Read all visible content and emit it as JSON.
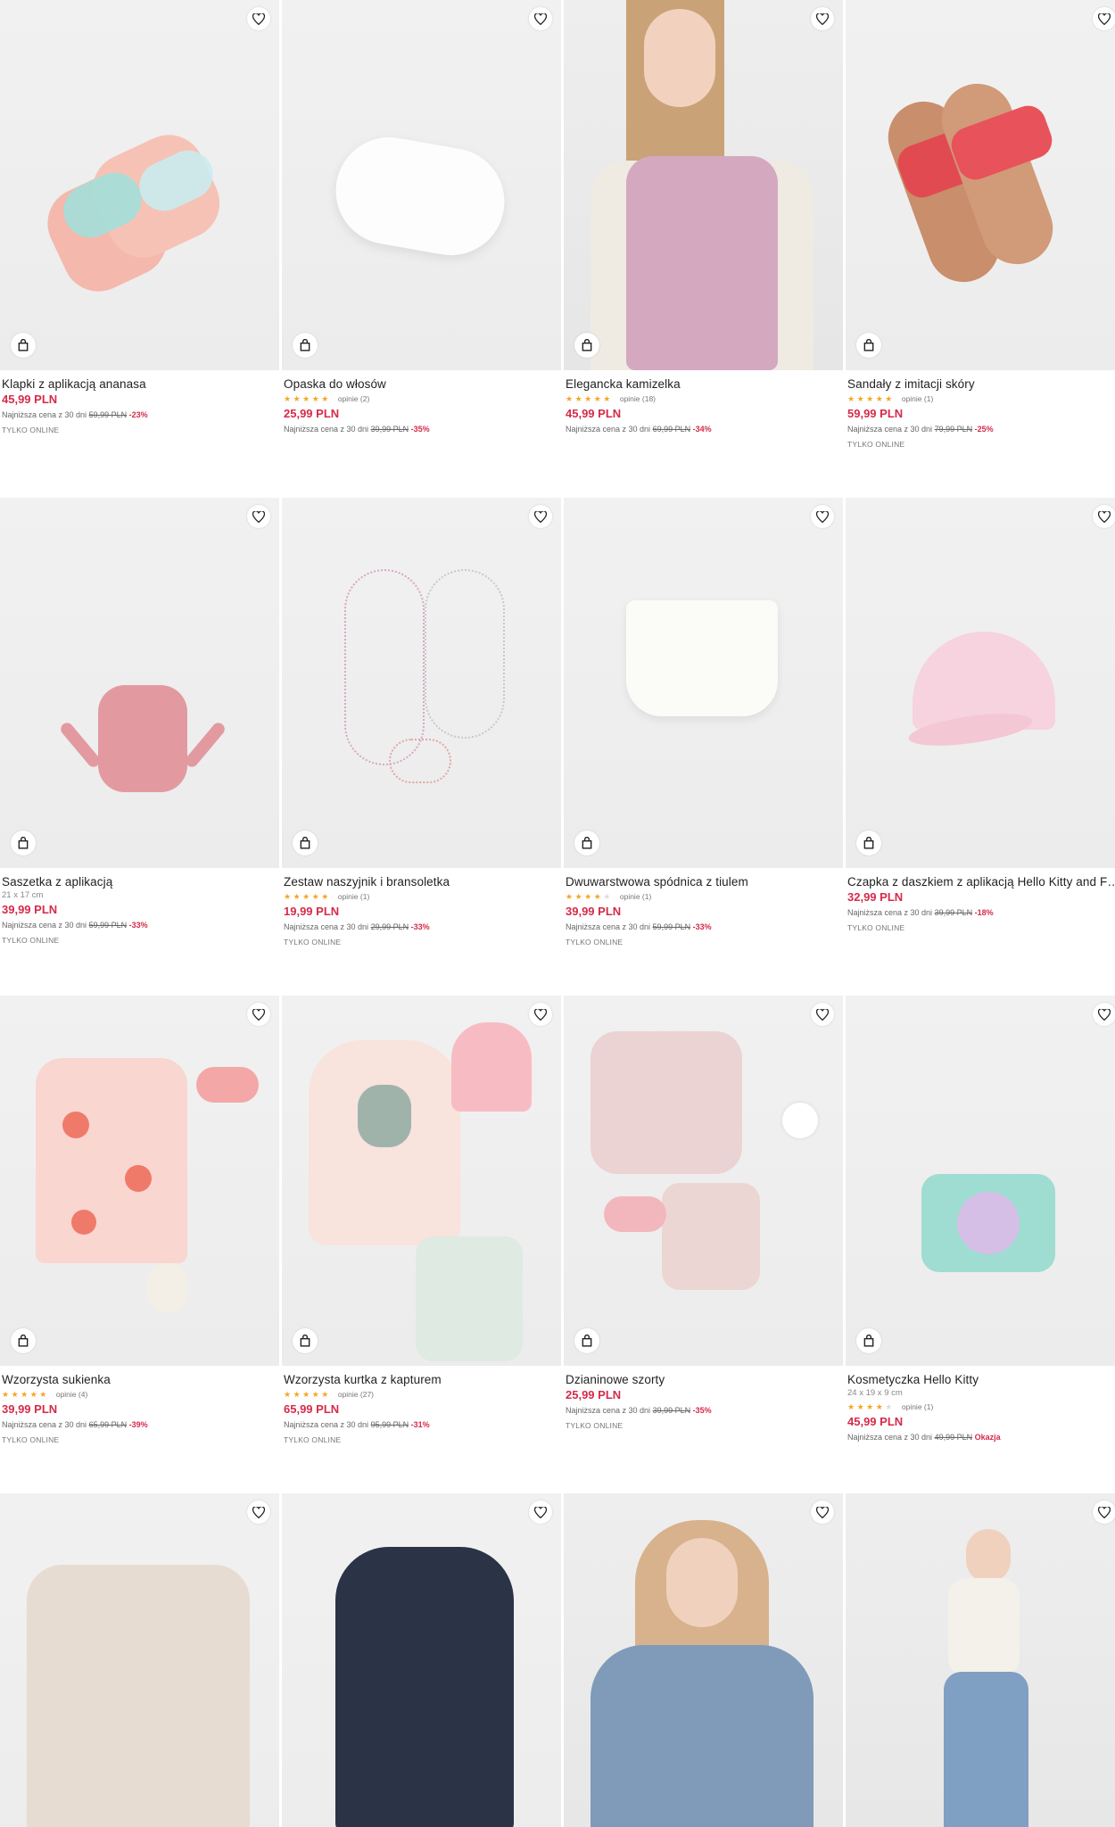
{
  "products": [
    {
      "name": "Klapki z aplikacją ananasa",
      "price": "45,99 PLN",
      "lowest_label": "Najniższa cena z 30 dni",
      "old_price": "59,99 PLN",
      "discount": "-23%",
      "badge": "TYLKO ONLINE"
    },
    {
      "name": "Opaska do włosów",
      "stars": "★★★★★",
      "reviews": "opinie (2)",
      "price": "25,99 PLN",
      "lowest_label": "Najniższa cena z 30 dni",
      "old_price": "39,99 PLN",
      "discount": "-35%"
    },
    {
      "name": "Elegancka kamizelka",
      "stars": "★★★★★",
      "reviews": "opinie (18)",
      "price": "45,99 PLN",
      "lowest_label": "Najniższa cena z 30 dni",
      "old_price": "69,99 PLN",
      "discount": "-34%"
    },
    {
      "name": "Sandały z imitacji skóry",
      "stars": "★★★★★",
      "reviews": "opinie (1)",
      "price": "59,99 PLN",
      "lowest_label": "Najniższa cena z 30 dni",
      "old_price": "79,99 PLN",
      "discount": "-25%",
      "badge": "TYLKO ONLINE"
    },
    {
      "name": "Saszetka z aplikacją",
      "dims": "21 x 17 cm",
      "price": "39,99 PLN",
      "lowest_label": "Najniższa cena z 30 dni",
      "old_price": "59,99 PLN",
      "discount": "-33%",
      "badge": "TYLKO ONLINE"
    },
    {
      "name": "Zestaw naszyjnik i bransoletka",
      "stars": "★★★★★",
      "reviews": "opinie (1)",
      "price": "19,99 PLN",
      "lowest_label": "Najniższa cena z 30 dni",
      "old_price": "29,99 PLN",
      "discount": "-33%",
      "badge": "TYLKO ONLINE"
    },
    {
      "name": "Dwuwarstwowa spódnica z tiulem",
      "stars": "★★★★",
      "stars_off": "★",
      "reviews": "opinie (1)",
      "price": "39,99 PLN",
      "lowest_label": "Najniższa cena z 30 dni",
      "old_price": "59,99 PLN",
      "discount": "-33%",
      "badge": "TYLKO ONLINE"
    },
    {
      "name": "Czapka z daszkiem z aplikacją Hello Kitty and Friends",
      "price": "32,99 PLN",
      "lowest_label": "Najniższa cena z 30 dni",
      "old_price": "39,99 PLN",
      "discount": "-18%",
      "badge": "TYLKO ONLINE"
    },
    {
      "name": "Wzorzysta sukienka",
      "stars": "★★★★★",
      "reviews": "opinie (4)",
      "price": "39,99 PLN",
      "lowest_label": "Najniższa cena z 30 dni",
      "old_price": "65,99 PLN",
      "discount": "-39%",
      "badge": "TYLKO ONLINE"
    },
    {
      "name": "Wzorzysta kurtka z kapturem",
      "stars": "★★★★★",
      "reviews": "opinie (27)",
      "price": "65,99 PLN",
      "lowest_label": "Najniższa cena z 30 dni",
      "old_price": "95,99 PLN",
      "discount": "-31%",
      "badge": "TYLKO ONLINE"
    },
    {
      "name": "Dzianinowe szorty",
      "price": "25,99 PLN",
      "lowest_label": "Najniższa cena z 30 dni",
      "old_price": "39,99 PLN",
      "discount": "-35%",
      "badge": "TYLKO ONLINE"
    },
    {
      "name": "Kosmetyczka Hello Kitty",
      "dims": "24 x 19 x 9 cm",
      "stars": "★★★★",
      "stars_off": "★",
      "reviews": "opinie (1)",
      "price": "45,99 PLN",
      "lowest_label": "Najniższa cena z 30 dni",
      "old_price": "49,99 PLN",
      "discount": "Okazja"
    },
    {
      "name": ""
    },
    {
      "name": ""
    },
    {
      "name": ""
    },
    {
      "name": ""
    }
  ],
  "icons": {
    "favorite": "heart-icon",
    "cart": "shopping-bag-icon"
  },
  "colors": {
    "price": "#d52b4a",
    "stars": "#f5a623",
    "background": "#ffffff"
  }
}
